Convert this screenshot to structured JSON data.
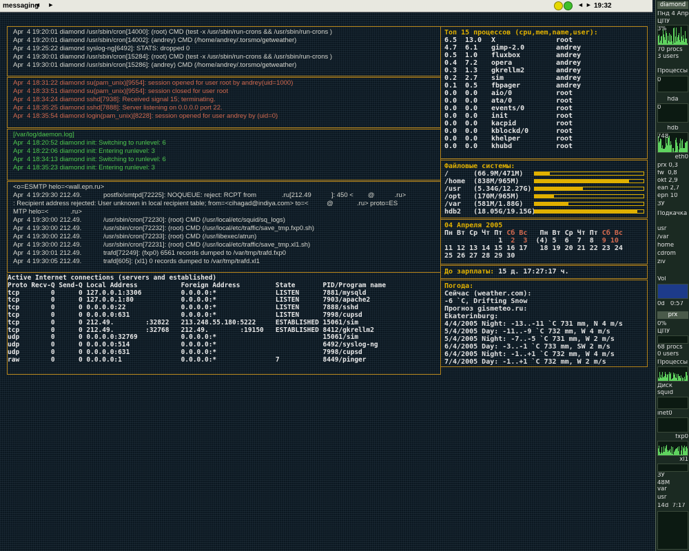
{
  "topbar": {
    "title": "messaging",
    "arrows_left": "◄ ►",
    "arrows_right": "◄►",
    "clock": "19:32"
  },
  "cron_log": [
    "Apr  4 19:20:01 diamond /usr/sbin/cron[14000]: (root) CMD (test -x /usr/sbin/run-crons && /usr/sbin/run-crons )",
    "Apr  4 19:20:01 diamond /usr/sbin/cron[14002]: (andrey) CMD (/home/andrey/.torsmo/getweather)",
    "Apr  4 19:25:22 diamond syslog-ng[6492]: STATS: dropped 0",
    "Apr  4 19:30:01 diamond /usr/sbin/cron[15284]: (root) CMD (test -x /usr/sbin/run-crons && /usr/sbin/run-crons )",
    "Apr  4 19:30:01 diamond /usr/sbin/cron[15286]: (andrey) CMD (/home/andrey/.torsmo/getweather)"
  ],
  "auth_log": [
    "Apr  4 18:31:22 diamond su(pam_unix)[9554]: session opened for user root by andrey(uid=1000)",
    "Apr  4 18:33:51 diamond su(pam_unix)[9554]: session closed for user root",
    "Apr  4 18:34:24 diamond sshd[7938]: Received signal 15; terminating.",
    "Apr  4 18:35:25 diamond sshd[7888]: Server listening on 0.0.0.0 port 22.",
    "Apr  4 18:35:54 diamond login(pam_unix)[8228]: session opened for user andrey by (uid=0)"
  ],
  "daemon_log": [
    "[/var/log/daemon.log]",
    "Apr  4 18:20:52 diamond init: Switching to runlevel: 6",
    "Apr  4 18:22:06 diamond init: Entering runlevel: 3",
    "Apr  4 18:34:13 diamond init: Switching to runlevel: 6",
    "Apr  4 18:35:23 diamond init: Entering runlevel: 3"
  ],
  "mail_log": [
    "<o=ESMTP helo=<wall.epn.ru>",
    "Apr  4 19:29:30 212.49.            postfix/smtpd[72225]: NOQUEUE: reject: RCPT from              .ru[212.49           ]: 450 <        @           .ru>",
    ": Recipient address rejected: User unknown in local recipient table; from=<cihagad@indiya.com> to=<          @             .ru> proto=ES",
    "MTP helo=<            .ru>",
    "Apr  4 19:30:00 212.49.            /usr/sbin/cron[72230]: (root) CMD (/usr/local/etc/squid/sq_logs)",
    "Apr  4 19:30:00 212.49.            /usr/sbin/cron[72232]: (root) CMD (/usr/local/etc/traffic/save_tmp.fxp0.sh)",
    "Apr  4 19:30:00 212.49.            /usr/sbin/cron[72233]: (root) CMD (/usr/libexec/atrun)",
    "Apr  4 19:30:00 212.49.            /usr/sbin/cron[72231]: (root) CMD (/usr/local/etc/traffic/save_tmp.xl1.sh)",
    "Apr  4 19:30:01 212.49.            trafd[72249]: (fxp0) 6561 records dumped to /var/tmp/trafd.fxp0",
    "Apr  4 19:30:05 212.49.            trafd[605]: (xl1) 0 records dumped to /var/tmp/trafd.xl1"
  ],
  "netstat": [
    "Active Internet connections (servers and established)",
    "Proto Recv-Q Send-Q Local Address           Foreign Address         State       PID/Program name",
    "tcp        0      0 127.0.0.1:3306          0.0.0.0:*               LISTEN      7881/mysqld",
    "tcp        0      0 127.0.0.1:80            0.0.0.0:*               LISTEN      7903/apache2",
    "tcp        0      0 0.0.0.0:22              0.0.0.0:*               LISTEN      7888/sshd",
    "tcp        0      0 0.0.0.0:631             0.0.0.0:*               LISTEN      7998/cupsd",
    "tcp        0      0 212.49.        :32822   213.248.55.180:5222     ESTABLISHED 15061/sim",
    "tcp        0      0 212.49.        :32768   212.49.        :19150   ESTABLISHED 8412/gkrellm2",
    "udp        0      0 0.0.0.0:32769           0.0.0.0:*                           15061/sim",
    "udp        0      0 0.0.0.0:514             0.0.0.0:*                           6492/syslog-ng",
    "udp        0      0 0.0.0.0:631             0.0.0.0:*                           7998/cupsd",
    "raw        0      0 0.0.0.0:1               0.0.0.0:*               7           8449/pinger"
  ],
  "processes": {
    "header": "Топ 15 процессов (cpu,mem,name,user):",
    "rows": [
      [
        "6.5",
        "13.0",
        "X",
        "root"
      ],
      [
        "4.7",
        "6.1",
        "gimp-2.0",
        "andrey"
      ],
      [
        "0.5",
        "1.0",
        "fluxbox",
        "andrey"
      ],
      [
        "0.4",
        "7.2",
        "opera",
        "andrey"
      ],
      [
        "0.3",
        "1.3",
        "gkrellm2",
        "andrey"
      ],
      [
        "0.2",
        "2.7",
        "sim",
        "andrey"
      ],
      [
        "0.1",
        "0.5",
        "fbpager",
        "andrey"
      ],
      [
        "0.0",
        "0.0",
        "aio/0",
        "root"
      ],
      [
        "0.0",
        "0.0",
        "ata/0",
        "root"
      ],
      [
        "0.0",
        "0.0",
        "events/0",
        "root"
      ],
      [
        "0.0",
        "0.0",
        "init",
        "root"
      ],
      [
        "0.0",
        "0.0",
        "kacpid",
        "root"
      ],
      [
        "0.0",
        "0.0",
        "kblockd/0",
        "root"
      ],
      [
        "0.0",
        "0.0",
        "khelper",
        "root"
      ],
      [
        "0.0",
        "0.0",
        "khubd",
        "root"
      ]
    ]
  },
  "filesystems": {
    "header": "Файловые системы:",
    "items": [
      {
        "label": "/      (66.9M/471M)",
        "used": 0.14
      },
      {
        "label": "/home  (838M/965M)",
        "used": 0.87
      },
      {
        "label": "/usr   (5.34G/12.27G)",
        "used": 0.44
      },
      {
        "label": "/opt   (170M/965M)",
        "used": 0.18
      },
      {
        "label": "/var   (581M/1.88G)",
        "used": 0.31
      },
      {
        "label": "hdb2   (18.05G/19.15G)",
        "used": 0.94
      }
    ]
  },
  "calendar": {
    "title": "04 Апреля 2005",
    "rows": [
      [
        "Пн Вт Ср Чт Пт ",
        "Сб Вс",
        "   Пн Вт Ср Чт Пт ",
        "Сб Вс"
      ],
      [
        "             1  ",
        "2  3",
        "  (4) 5  6  7  8  ",
        "9 10"
      ],
      [
        "11 12 13 14 15 16 17   18 19 20 21 22 23 24",
        "",
        "",
        ""
      ],
      [
        "25 26 27 28 29 30",
        "",
        "",
        ""
      ]
    ]
  },
  "salary": {
    "label": "До зарплаты:",
    "value": " 15 д. 17:27:17 ч."
  },
  "weather": {
    "title": "Погода:",
    "now_label": "Сейчас (weather.com):",
    "now_value": "-6 `C, Drifting Snow",
    "forecast_label": "Прогноз gismeteo.ru:",
    "city": "Ekaterinburg:",
    "lines": [
      "4/4/2005 Night: -13..-11 `C 731 mm, N 4 m/s",
      "5/4/2005 Day: -11..-9 `C 732 mm, W 4 m/s",
      "5/4/2005 Night: -7..-5 `C 731 mm, W 2 m/s",
      "6/4/2005 Day: -3..-1 `C 733 mm, SW 2 m/s",
      "6/4/2005 Night: -1..+1 `C 732 mm, W 4 m/s",
      "7/4/2005 Day: -1..+1 `C 732 mm, W 2 m/s"
    ]
  },
  "gkrellm": {
    "host": "diamond",
    "date": "Пнд 4 Апр",
    "cpu1": "ЦПУ",
    "cpu1_pct": "3%",
    "procs": "70 procs",
    "users": "3 users",
    "processes": "Процессы",
    "zero": "0",
    "hda": "hda",
    "hdb": "hdb",
    "hdb_val": "748",
    "eth0": "eth0",
    "sensors": [
      "prx 0,3",
      "fw  0,8",
      "okt 2,9",
      "ean 2,7",
      "epn 10"
    ],
    "sensor_hdr": "ЗУ",
    "fan_hdr": "Подкачка",
    "mounts": [
      "usr",
      "/var",
      "home",
      "cdrom",
      "ziv"
    ],
    "vol": "Vol",
    "uptime": "0d   0:57",
    "prx": "prx",
    "prx_pct": "0%",
    "cpu2": "ЦПУ",
    "procs2": "68 procs",
    "users2": "0 users",
    "processes2": "Процессы",
    "disk": "Диск",
    "squid": "squid",
    "inet": "inet0",
    "fxp": "fxp0",
    "xl": "xl1",
    "mem": "ЗУ",
    "mem_val": "48M",
    "mounts2": [
      "var",
      "usr"
    ],
    "uptime2": "14d  7:17"
  }
}
